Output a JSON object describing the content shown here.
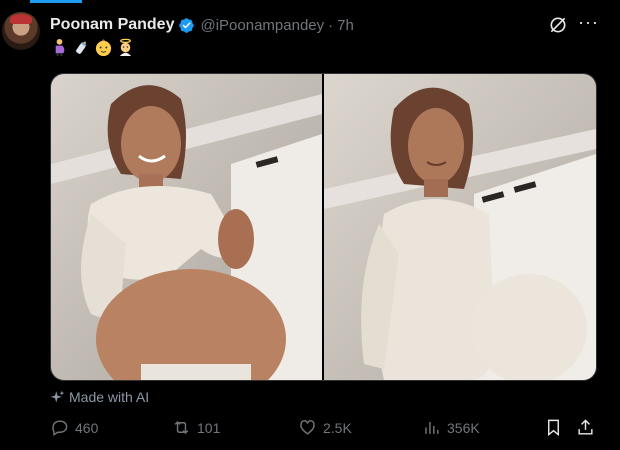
{
  "post": {
    "author_name": "Poonam Pandey",
    "handle": "@iPoonampandey",
    "separator": "·",
    "time": "7h",
    "text_emojis": [
      "pregnant-person-emoji",
      "baby-bottle-emoji",
      "baby-emoji",
      "baby-angel-emoji"
    ],
    "media_label": "Made with AI",
    "more_label": "···"
  },
  "actions": {
    "replies": "460",
    "reposts": "101",
    "likes": "2.5K",
    "views": "356K"
  },
  "icons": {
    "verified": "verified-badge-icon",
    "grok": "grok-icon",
    "more": "more-options-icon",
    "spark": "sparkle-icon",
    "reply": "reply-icon",
    "repost": "repost-icon",
    "like": "heart-icon",
    "views": "views-chart-icon",
    "bookmark": "bookmark-icon",
    "share": "share-icon"
  },
  "colors": {
    "background": "#000000",
    "text_primary": "#e7e9ea",
    "text_secondary": "#71767b",
    "accent": "#1d9bf0"
  }
}
